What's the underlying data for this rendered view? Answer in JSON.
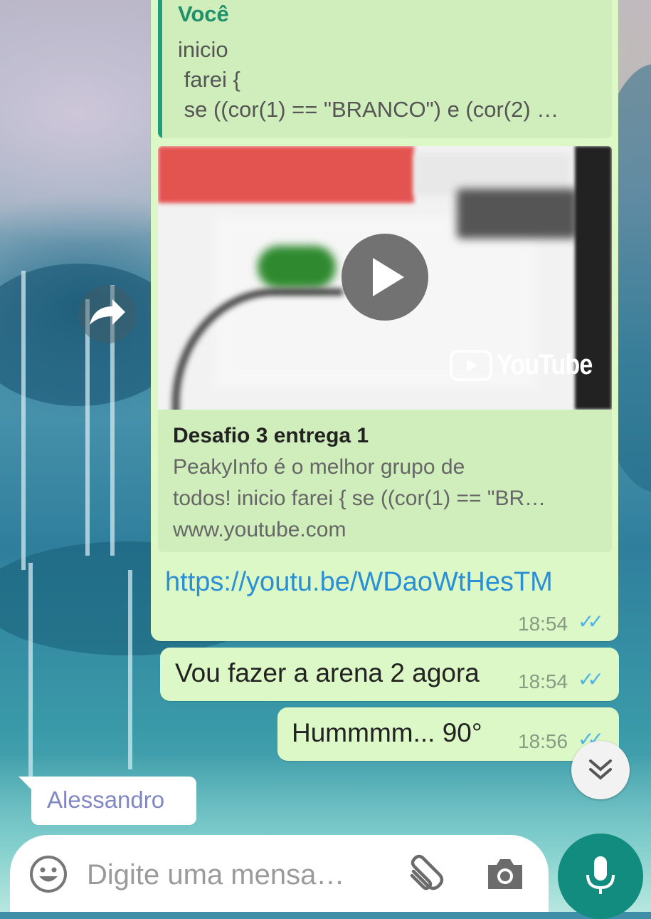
{
  "chat": {
    "quoted": {
      "author": "Você",
      "lines": [
        "inicio",
        " farei {",
        " se ((cor(1) == \"BRANCO\") e (cor(2) …"
      ]
    },
    "link_preview": {
      "video_brand": "YouTube",
      "title": "Desafio 3 entrega 1",
      "description_lines": [
        "PeakyInfo é o melhor grupo de",
        "todos! inicio farei { se ((cor(1) == \"BR…"
      ],
      "domain": "www.youtube.com"
    },
    "link_message": {
      "url": "https://youtu.be/WDaoWtHesTM",
      "time": "18:54",
      "status": "read"
    },
    "messages": [
      {
        "text": "Vou fazer a arena 2 agora",
        "time": "18:54",
        "status": "read"
      },
      {
        "text": "Hummmm... 90°",
        "time": "18:56",
        "status": "read"
      }
    ],
    "typing_contact": "Alessandro"
  },
  "composer": {
    "placeholder": "Digite uma mensa…",
    "icons": [
      "emoji-icon",
      "attach-icon",
      "camera-icon",
      "mic-icon"
    ]
  },
  "colors": {
    "outgoing_bubble": "#dcf8c6",
    "tick_read": "#4fb3e8",
    "accent": "#128c7e",
    "link": "#2a8fd6"
  }
}
